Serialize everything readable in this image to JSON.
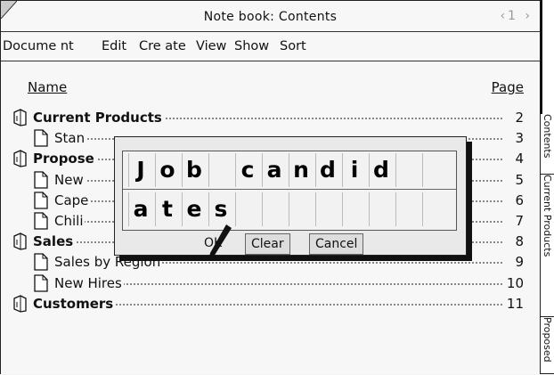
{
  "window": {
    "title": "Note book: Contents",
    "pager": "‹1 ›"
  },
  "menu": [
    "Docume nt",
    "Edit",
    "Cre ate",
    "View",
    "Show",
    "Sort"
  ],
  "columns": {
    "name": "Name",
    "page": "Page"
  },
  "rows": [
    {
      "label": "Current Products",
      "page": "2",
      "type": "book"
    },
    {
      "label": "Stan",
      "page": "3",
      "type": "doc"
    },
    {
      "label": "Propose",
      "page": "4",
      "type": "book"
    },
    {
      "label": "New",
      "page": "5",
      "type": "doc"
    },
    {
      "label": "Cape",
      "page": "6",
      "type": "doc"
    },
    {
      "label": "Chili",
      "page": "7",
      "type": "doc"
    },
    {
      "label": "Sales",
      "page": "8",
      "type": "book"
    },
    {
      "label": "Sales by Region",
      "page": "9",
      "type": "doc"
    },
    {
      "label": "New Hires",
      "page": "10",
      "type": "doc"
    },
    {
      "label": "Customers",
      "page": "11",
      "type": "book"
    }
  ],
  "tabs": [
    "Contents",
    "Current Products",
    "Proposed"
  ],
  "dialog": {
    "line1": [
      "J",
      "o",
      "b",
      "",
      "c",
      "a",
      "n",
      "d",
      "i",
      "d",
      "",
      ""
    ],
    "line2": [
      "a",
      "t",
      "e",
      "s",
      "",
      "",
      "",
      "",
      "",
      "",
      "",
      ""
    ],
    "ok": "OK",
    "clear": "Clear",
    "cancel": "Cancel"
  }
}
